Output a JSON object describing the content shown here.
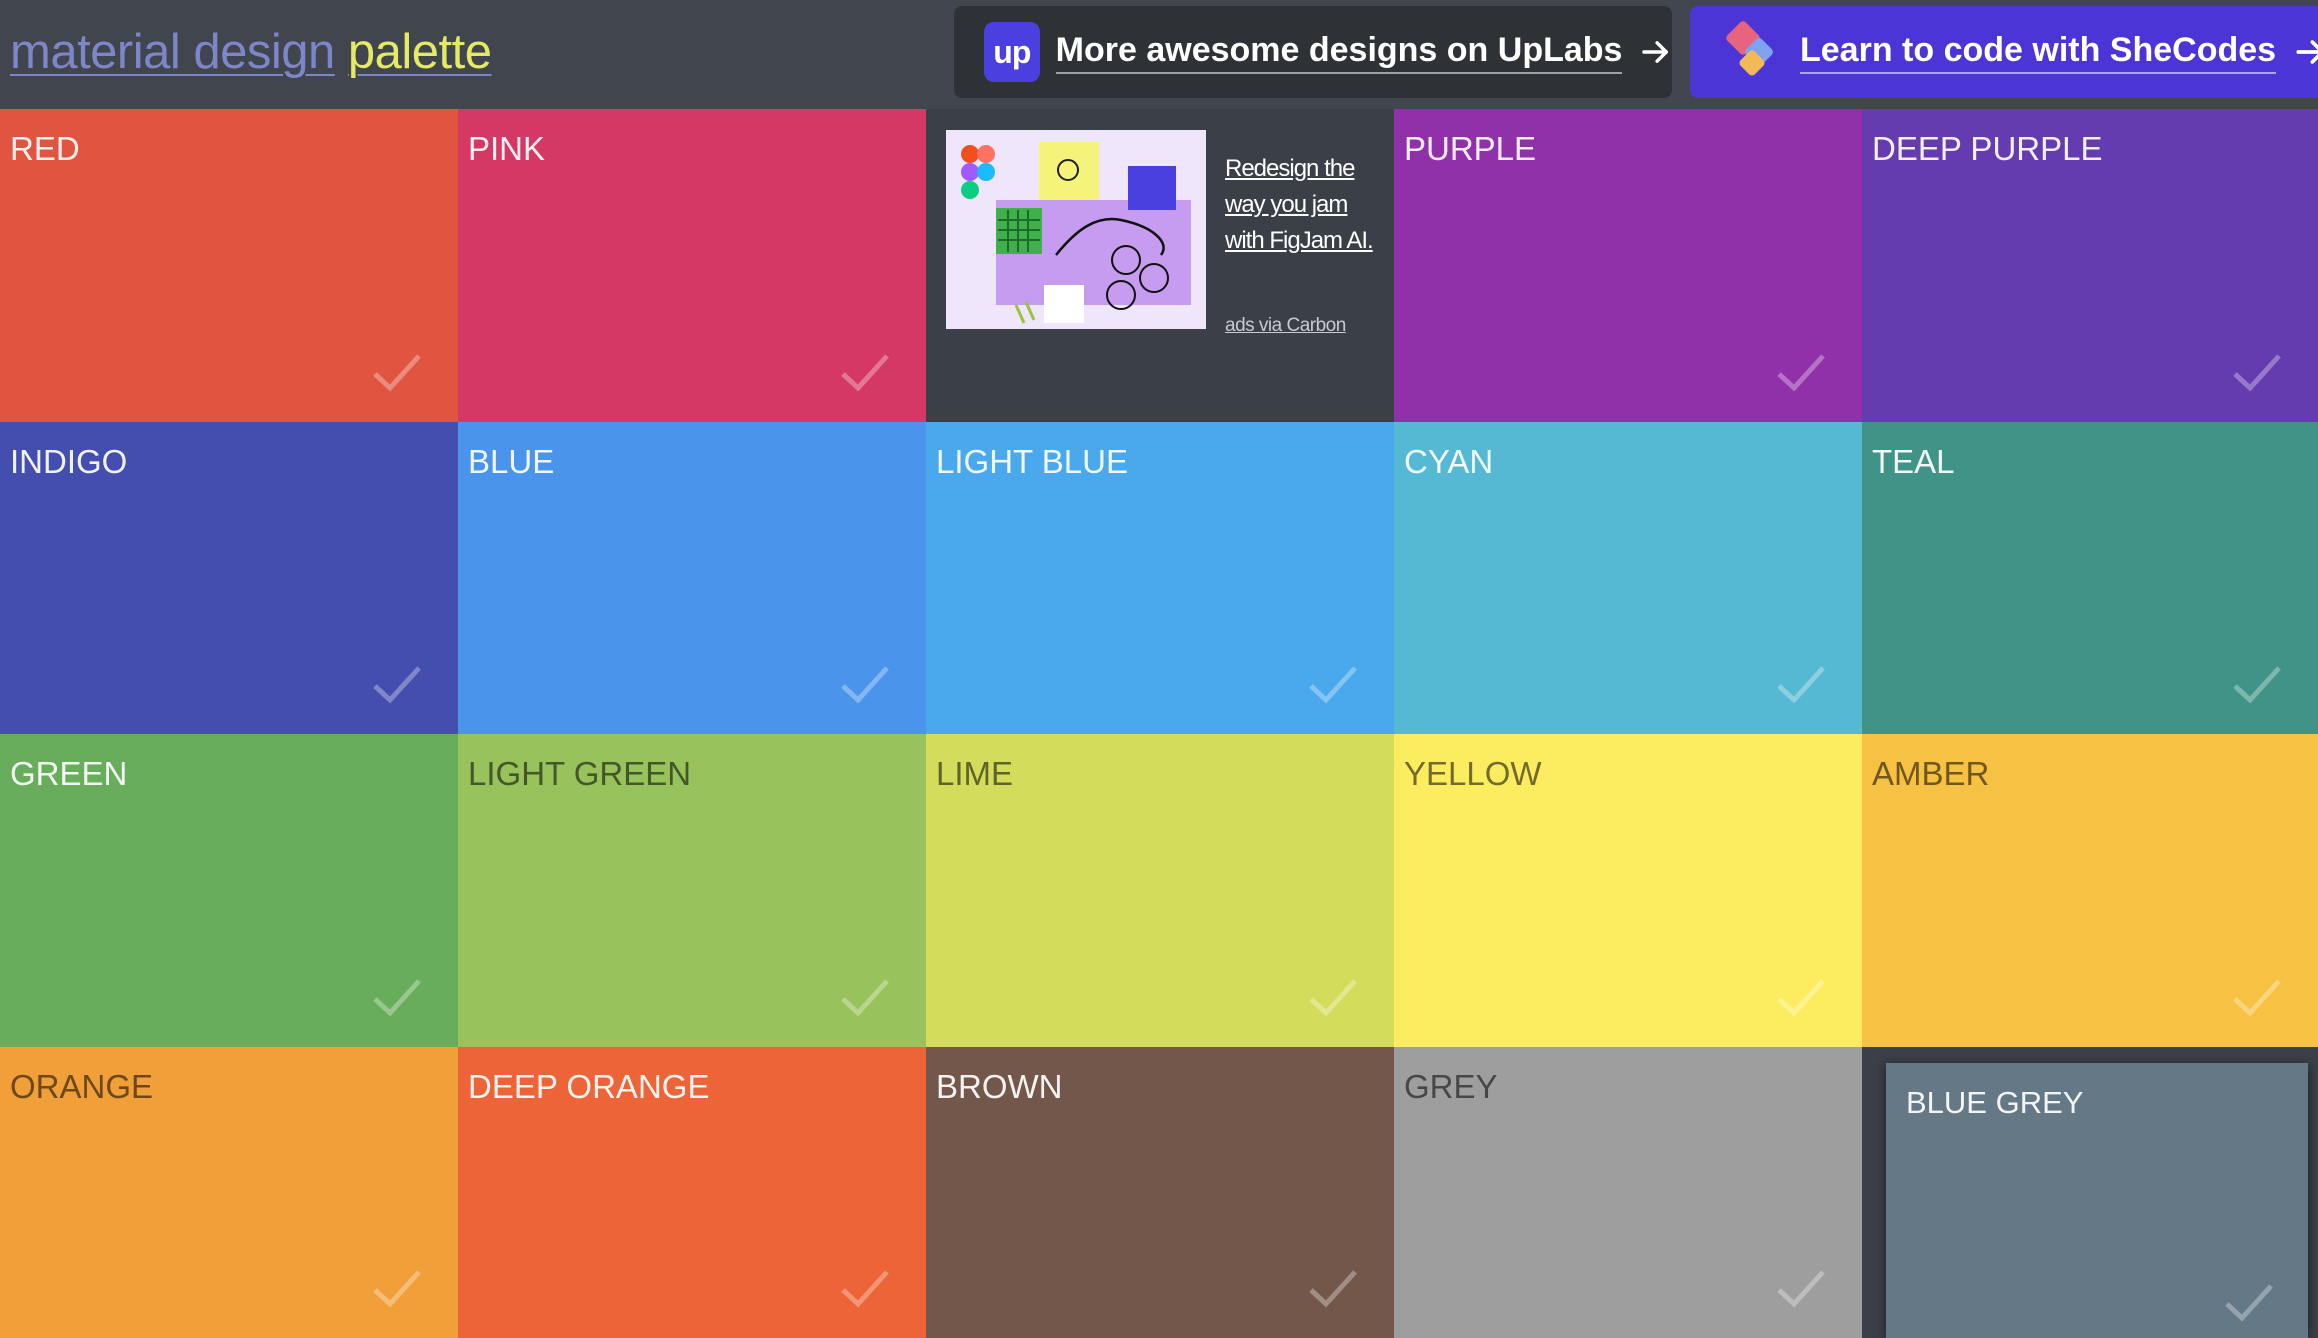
{
  "header": {
    "logo_word1": "material design",
    "logo_word2": "palette",
    "promo_uplabs": {
      "badge": "up",
      "label": "More awesome designs on UpLabs"
    },
    "promo_shecodes": {
      "label": "Learn to code with SheCodes"
    }
  },
  "ad": {
    "text": "Redesign the way you jam with FigJam AI.",
    "via": "ads via Carbon"
  },
  "colors": [
    {
      "name": "RED",
      "hex": "#e15540",
      "text": "light"
    },
    {
      "name": "PINK",
      "hex": "#d63864",
      "text": "light"
    },
    {
      "name": "PURPLE",
      "hex": "#9131aa",
      "text": "light"
    },
    {
      "name": "DEEP PURPLE",
      "hex": "#653cb0",
      "text": "light"
    },
    {
      "name": "INDIGO",
      "hex": "#444eae",
      "text": "light"
    },
    {
      "name": "BLUE",
      "hex": "#4a94ec",
      "text": "light"
    },
    {
      "name": "LIGHT BLUE",
      "hex": "#49a9ec",
      "text": "light"
    },
    {
      "name": "CYAN",
      "hex": "#55b9d3",
      "text": "light"
    },
    {
      "name": "TEAL",
      "hex": "#409487",
      "text": "light"
    },
    {
      "name": "GREEN",
      "hex": "#67ad5b",
      "text": "light"
    },
    {
      "name": "LIGHT GREEN",
      "hex": "#98c25c",
      "text": "dark"
    },
    {
      "name": "LIME",
      "hex": "#d3dd5b",
      "text": "dark"
    },
    {
      "name": "YELLOW",
      "hex": "#fced60",
      "text": "dark"
    },
    {
      "name": "AMBER",
      "hex": "#f7c243",
      "text": "dark"
    },
    {
      "name": "ORANGE",
      "hex": "#f19f38",
      "text": "dark"
    },
    {
      "name": "DEEP ORANGE",
      "hex": "#ec6437",
      "text": "light"
    },
    {
      "name": "BROWN",
      "hex": "#74574b",
      "text": "light"
    },
    {
      "name": "GREY",
      "hex": "#9e9e9e",
      "text": "dark"
    },
    {
      "name": "BLUE GREY",
      "hex": "#647886",
      "text": "light"
    }
  ]
}
